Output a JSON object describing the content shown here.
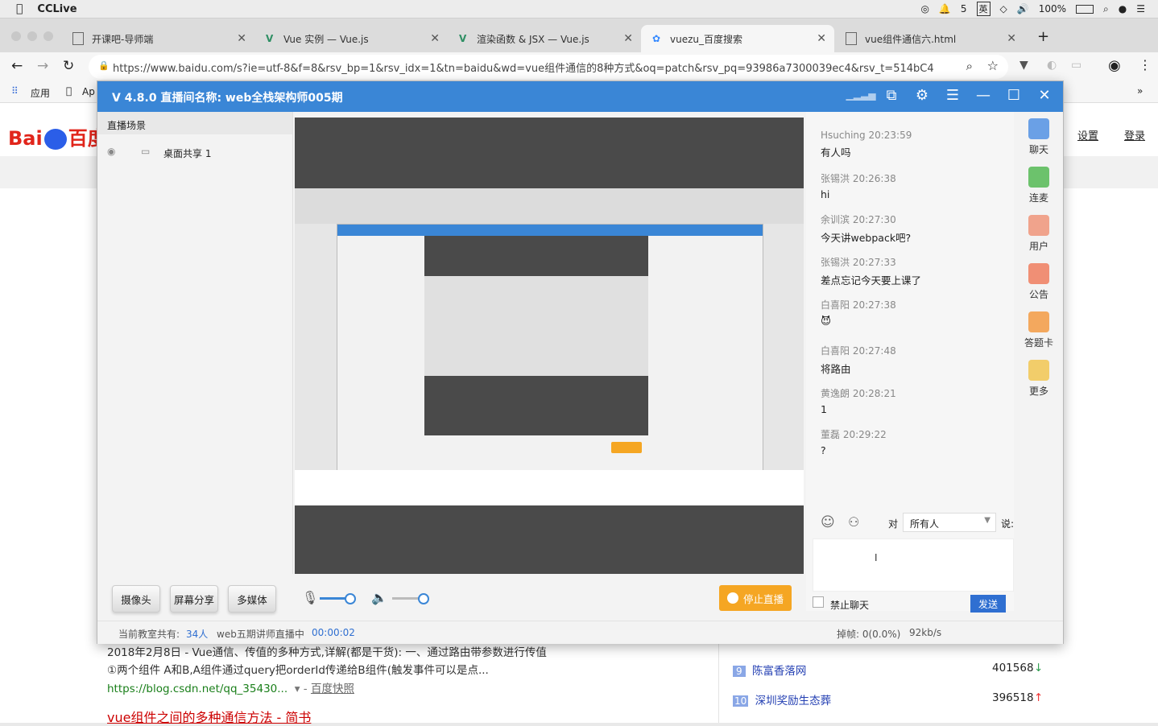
{
  "menubar": {
    "app_name": "CCLive",
    "battery": "100%",
    "ime": "英",
    "input_count": "5"
  },
  "tabs": [
    {
      "title": "开课吧-导师端",
      "active": false
    },
    {
      "title": "Vue 实例 — Vue.js",
      "active": false
    },
    {
      "title": "渲染函数 & JSX — Vue.js",
      "active": false
    },
    {
      "title": "vuezu_百度搜索",
      "active": true
    },
    {
      "title": "vue组件通信六.html",
      "active": false
    }
  ],
  "toolbar": {
    "url": "https://www.baidu.com/s?ie=utf-8&f=8&rsv_bp=1&rsv_idx=1&tn=baidu&wd=vue组件通信的8种方式&oq=patch&rsv_pq=93986a7300039ec4&rsv_t=514bC4g..."
  },
  "bookmarks": {
    "apps": "应用",
    "ap": "Ap"
  },
  "baidu": {
    "logo_left": "Bai",
    "logo_right": "百度",
    "settings": "设置",
    "login": "登录",
    "result_line1": "2018年2月8日 - Vue通信、传值的多种方式,详解(都是干货):   一、通过路由带参数进行传值",
    "result_line2": "①两个组件 A和B,A组件通过query把orderId传递给B组件(触发事件可以是点...",
    "result_link": "https://blog.csdn.net/qq_35430...",
    "snapshot": "百度快照",
    "next_title": "vue组件之间的多种通信方法 - 简书",
    "hot": [
      {
        "rank": "9",
        "name": "陈富香落网",
        "count": "401568",
        "trend": "down"
      },
      {
        "rank": "10",
        "name": "深圳奖励生态葬",
        "count": "396518",
        "trend": "up"
      }
    ]
  },
  "app": {
    "title": "V 4.8.0  直播间名称: web全栈架构师005期",
    "left": {
      "section": "直播场景",
      "scene": "桌面共享 1"
    },
    "controls": {
      "camera": "摄像头",
      "screen_share": "屏幕分享",
      "media": "多媒体",
      "stop": "停止直播"
    },
    "chat": {
      "messages": [
        {
          "user": "Hsuching",
          "time": "20:23:59",
          "text": "有人吗"
        },
        {
          "user": "张锡洪",
          "time": "20:26:38",
          "text": "hi"
        },
        {
          "user": "余训滨",
          "time": "20:27:30",
          "text": "今天讲webpack吧?"
        },
        {
          "user": "张锡洪",
          "time": "20:27:33",
          "text": "差点忘记今天要上课了"
        },
        {
          "user": "白喜阳",
          "time": "20:27:38",
          "text": "😈"
        },
        {
          "user": "白喜阳",
          "time": "20:27:48",
          "text": "将路由"
        },
        {
          "user": "黄逸朗",
          "time": "20:28:21",
          "text": "1"
        },
        {
          "user": "董磊",
          "time": "20:29:22",
          "text": "?"
        }
      ],
      "to_label": "对",
      "to_value": "所有人",
      "say_label": "说:",
      "ban_label": "禁止聊天",
      "send": "发送"
    },
    "sidebar": [
      "聊天",
      "连麦",
      "用户",
      "公告",
      "答题卡",
      "更多"
    ],
    "status": {
      "prefix": "当前教室共有:",
      "count": "34人",
      "room": "web五期讲师直播中",
      "time": "00:00:02",
      "drop": "掉帧: 0(0.0%)",
      "rate": "92kb/s"
    }
  }
}
